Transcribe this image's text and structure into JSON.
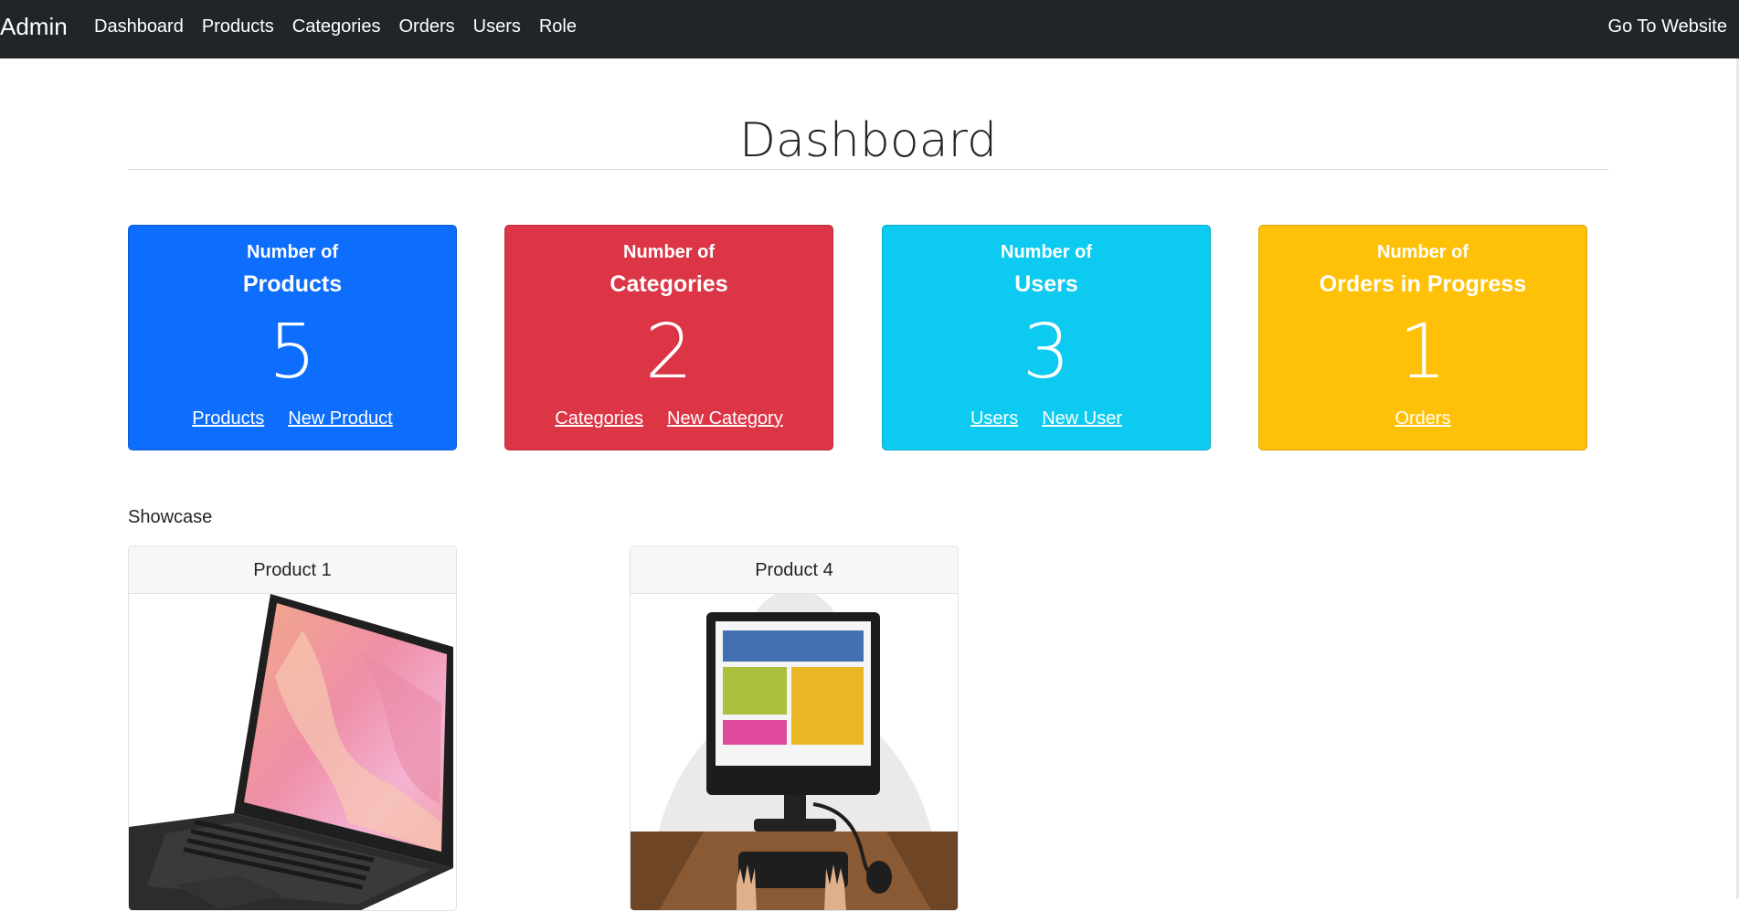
{
  "navbar": {
    "brand": "Admin",
    "links": [
      "Dashboard",
      "Products",
      "Categories",
      "Orders",
      "Users",
      "Role"
    ],
    "right_link": "Go To Website"
  },
  "page": {
    "title": "Dashboard"
  },
  "cards": [
    {
      "prefix": "Number of",
      "title": "Products",
      "count": "5",
      "color": "#0d6efd",
      "links": [
        "Products",
        "New Product"
      ]
    },
    {
      "prefix": "Number of",
      "title": "Categories",
      "count": "2",
      "color": "#dc3545",
      "links": [
        "Categories",
        "New Category"
      ]
    },
    {
      "prefix": "Number of",
      "title": "Users",
      "count": "3",
      "color": "#0dcaf0",
      "links": [
        "Users",
        "New User"
      ]
    },
    {
      "prefix": "Number of",
      "title": "Orders in Progress",
      "count": "1",
      "color": "#ffc107",
      "links": [
        "Orders"
      ]
    }
  ],
  "showcase": {
    "label": "Showcase",
    "products": [
      {
        "name": "Product 1",
        "image": "laptop-image"
      },
      {
        "name": "Product 4",
        "image": "computer-desk-illustration"
      }
    ]
  }
}
